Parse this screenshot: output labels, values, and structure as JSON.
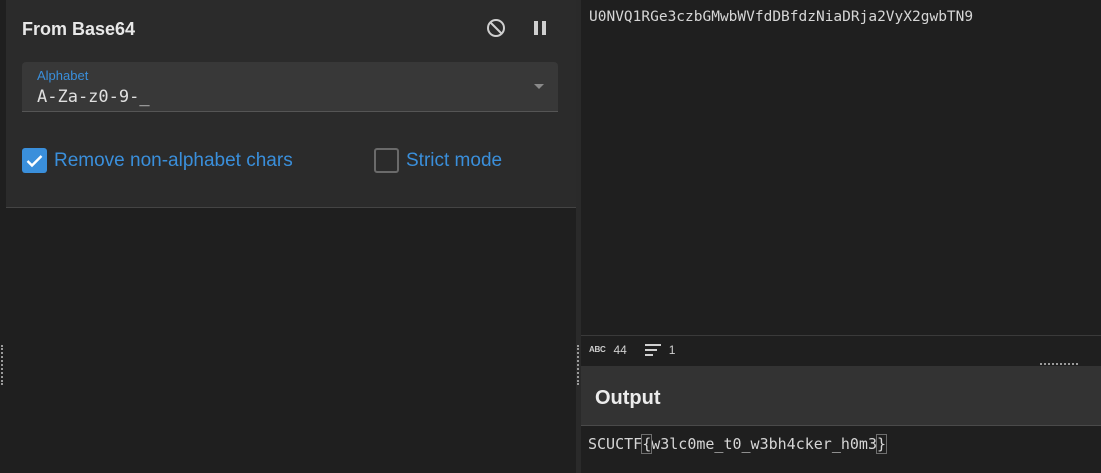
{
  "operation": {
    "title": "From Base64",
    "disable_icon": "disable-icon",
    "pause_icon": "pause-icon",
    "alphabet": {
      "label": "Alphabet",
      "value": "A-Za-z0-9-_"
    },
    "remove_non_alphabet": {
      "label": "Remove non-alphabet chars",
      "checked": true
    },
    "strict_mode": {
      "label": "Strict mode",
      "checked": false
    }
  },
  "input": {
    "text": "U0NVQ1RGe3czbGMwbWVfdDBfdzNiaDRja2VyX2gwbTN9",
    "status": {
      "length_icon": "abc-icon",
      "length": "44",
      "lines_icon": "lines-icon",
      "lines": "1"
    }
  },
  "output": {
    "title": "Output",
    "text_prefix": "SCUCTF",
    "brace_open": "{",
    "text_body": "w3lc0me_t0_w3bh4cker_h0m3",
    "brace_close": "}"
  },
  "colors": {
    "accent": "#3a8fdb",
    "background": "#1f1f1f",
    "card": "#2b2b2b"
  }
}
